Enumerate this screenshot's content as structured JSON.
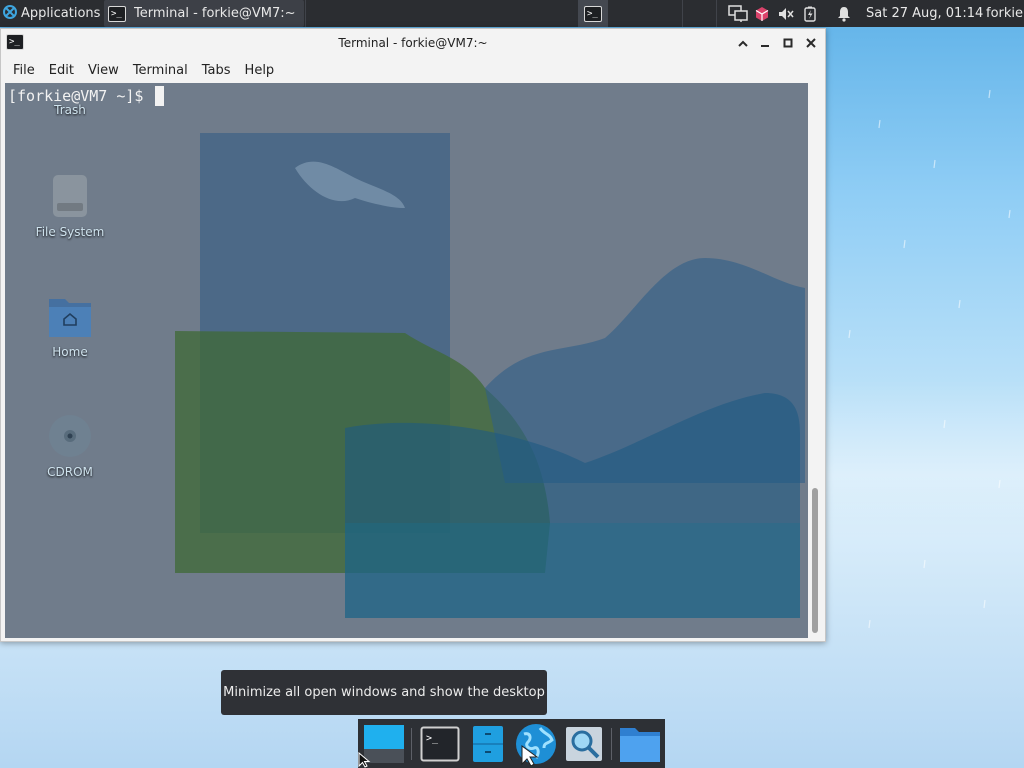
{
  "top_panel": {
    "applications_label": "Applications",
    "task_title": "Terminal - forkie@VM7:~",
    "clock": "Sat 27 Aug, 01:14",
    "user": "forkie"
  },
  "desktop_icons": [
    {
      "label": "Trash"
    },
    {
      "label": "File System"
    },
    {
      "label": "Home"
    },
    {
      "label": "CDROM"
    }
  ],
  "terminal": {
    "title": "Terminal - forkie@VM7:~",
    "menu": [
      "File",
      "Edit",
      "View",
      "Terminal",
      "Tabs",
      "Help"
    ],
    "prompt": "[forkie@VM7 ~]$ "
  },
  "tooltip": "Minimize all open windows and show the desktop",
  "dock": {
    "items": [
      "show-desktop",
      "terminal",
      "file-manager-drawer",
      "web-browser",
      "app-finder",
      "home-folder"
    ]
  },
  "colors": {
    "panel": "#2b2d31",
    "accent_blue": "#1fa8e6",
    "terminal_bg": "#3a5a78"
  }
}
